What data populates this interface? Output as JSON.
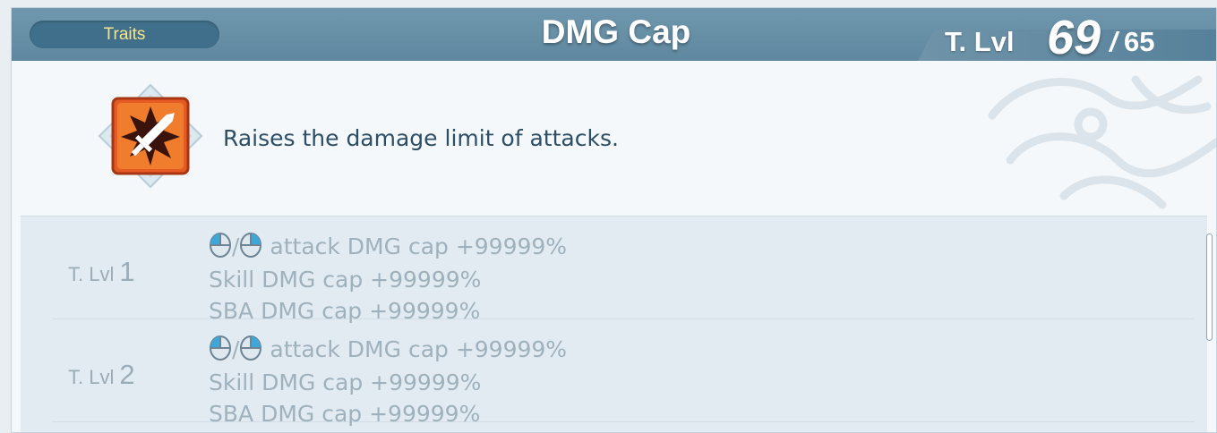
{
  "header": {
    "category_label": "Traits",
    "title": "DMG Cap",
    "tlvl_label": "T. Lvl",
    "tlvl_current": "69",
    "tlvl_separator": "/",
    "tlvl_max": "65"
  },
  "trait": {
    "icon": "sword-burst-icon",
    "description": "Raises the damage limit of attacks."
  },
  "levels": [
    {
      "label": "T. Lvl",
      "number": "1",
      "effects": {
        "attack_separator": "/",
        "attack": "attack DMG cap +99999%",
        "skill": "Skill DMG cap +99999%",
        "sba": "SBA DMG cap +99999%"
      }
    },
    {
      "label": "T. Lvl",
      "number": "2",
      "effects": {
        "attack_separator": "/",
        "attack": "attack DMG cap +99999%",
        "skill": "Skill DMG cap +99999%",
        "sba": "SBA DMG cap +99999%"
      }
    }
  ],
  "colors": {
    "header": "#6f97ad",
    "traits_text": "#f7e58a",
    "description": "#2d4e64",
    "level_text": "#9fb1bd"
  }
}
